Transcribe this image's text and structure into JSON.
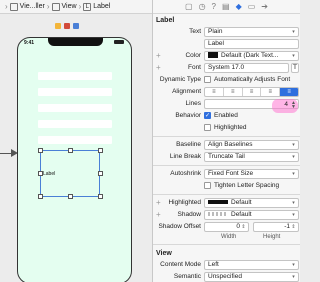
{
  "breadcrumb": {
    "items": [
      "Vie...ller",
      "View",
      "Label"
    ]
  },
  "canvas": {
    "scene_icons": [
      "#f3b53a",
      "#d24a3a",
      "#4a7fd6"
    ],
    "time": "9:41",
    "selected_label_text": "Label",
    "text_fields": 5
  },
  "inspector": {
    "tab_icons": [
      "file-icon",
      "clock-icon",
      "help-icon",
      "identity-icon",
      "attributes-icon",
      "ruler-icon",
      "connections-icon"
    ],
    "label_section": {
      "title": "Label",
      "text_label": "Text",
      "text_value": "Plain",
      "text_content": "Label",
      "color_label": "Color",
      "color_value": "Default (Dark Text...",
      "font_label": "Font",
      "font_value": "System 17.0",
      "dynamic_type_label": "Dynamic Type",
      "dynamic_type_value": "Automatically Adjusts Font",
      "alignment_label": "Alignment",
      "lines_label": "Lines",
      "lines_value": "4",
      "behavior_label": "Behavior",
      "enabled_label": "Enabled",
      "highlighted_check_label": "Highlighted",
      "baseline_label": "Baseline",
      "baseline_value": "Align Baselines",
      "line_break_label": "Line Break",
      "line_break_value": "Truncate Tail",
      "autoshrink_label": "Autoshrink",
      "autoshrink_value": "Fixed Font Size",
      "tighten_label": "Tighten Letter Spacing",
      "highlighted_label": "Highlighted",
      "highlighted_value": "Default",
      "shadow_label": "Shadow",
      "shadow_value": "Default",
      "shadow_offset_label": "Shadow Offset",
      "shadow_offset_w": "0",
      "shadow_offset_h": "-1",
      "width_label": "Width",
      "height_label": "Height"
    },
    "view_section": {
      "title": "View",
      "content_mode_label": "Content Mode",
      "content_mode_value": "Left",
      "semantic_label": "Semantic",
      "semantic_value": "Unspecified"
    }
  },
  "colors": {
    "accent": "#2f6fde",
    "phone_bg": "#e4fef0",
    "highlight_pink": "#ff78d2"
  }
}
